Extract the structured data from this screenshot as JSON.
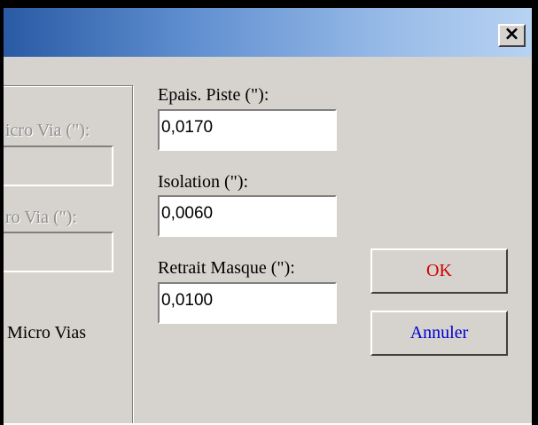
{
  "window": {
    "close_label": "×"
  },
  "left_group": {
    "field1_label": "icro Via (\"):",
    "field2_label": "ro Via (\"):",
    "checkbox_label": "Micro Vias"
  },
  "track_thickness": {
    "label": "Epais. Piste (\"):",
    "value": "0,0170"
  },
  "isolation": {
    "label": "Isolation (\"):",
    "value": "0,0060"
  },
  "mask_shrink": {
    "label": "Retrait Masque (\"):",
    "value": "0,0100"
  },
  "buttons": {
    "ok_label": "OK",
    "ok_color": "#d00000",
    "cancel_label": "Annuler",
    "cancel_color": "#0000d0"
  }
}
